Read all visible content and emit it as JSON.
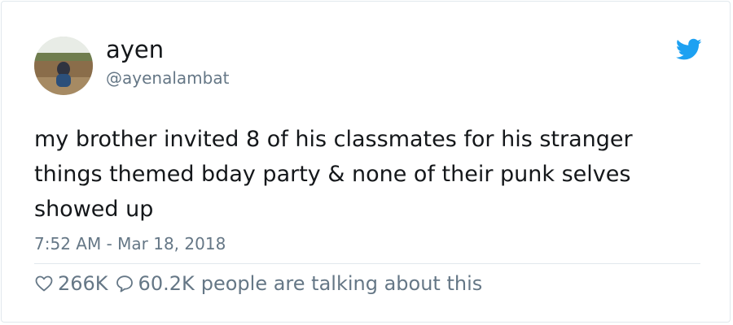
{
  "user": {
    "display_name": "ayen",
    "handle": "@ayenalambat"
  },
  "tweet": {
    "text": "my brother invited 8 of his classmates for his stranger things themed bday party & none of their punk selves showed up",
    "timestamp": "7:52 AM - Mar 18, 2018"
  },
  "stats": {
    "likes": "266K",
    "replies": "60.2K",
    "talking_label": "people are talking about this"
  },
  "icons": {
    "brand": "twitter-bird-icon",
    "like": "heart-outline-icon",
    "reply": "speech-bubble-icon"
  },
  "colors": {
    "brand_blue": "#1da1f2",
    "text": "#14171a",
    "muted": "#657786"
  }
}
